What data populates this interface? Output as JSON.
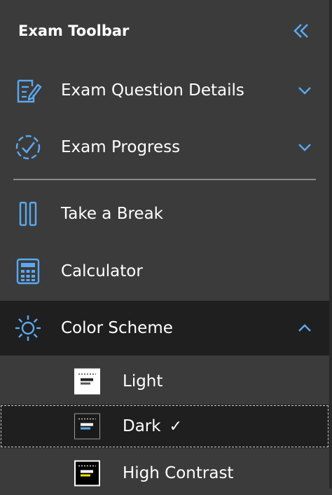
{
  "toolbar": {
    "title": "Exam Toolbar",
    "collapse_icon": "double-chevron-left-icon"
  },
  "items": {
    "question_details": {
      "label": "Exam Question Details",
      "icon": "edit-document-icon",
      "state": "collapsed"
    },
    "progress": {
      "label": "Exam Progress",
      "icon": "progress-circle-check-icon",
      "state": "collapsed"
    },
    "break": {
      "label": "Take a Break",
      "icon": "pause-icon"
    },
    "calculator": {
      "label": "Calculator",
      "icon": "calculator-icon"
    },
    "color_scheme": {
      "label": "Color Scheme",
      "icon": "sun-icon",
      "state": "expanded",
      "options": {
        "light": {
          "label": "Light"
        },
        "dark": {
          "label": "Dark",
          "selected": true,
          "check": "✓"
        },
        "high_contrast": {
          "label": "High Contrast"
        }
      }
    }
  },
  "colors": {
    "background": "#3b3b3b",
    "expanded_background": "#1f1f1f",
    "accent": "#5aa9f0",
    "text": "#ffffff"
  }
}
